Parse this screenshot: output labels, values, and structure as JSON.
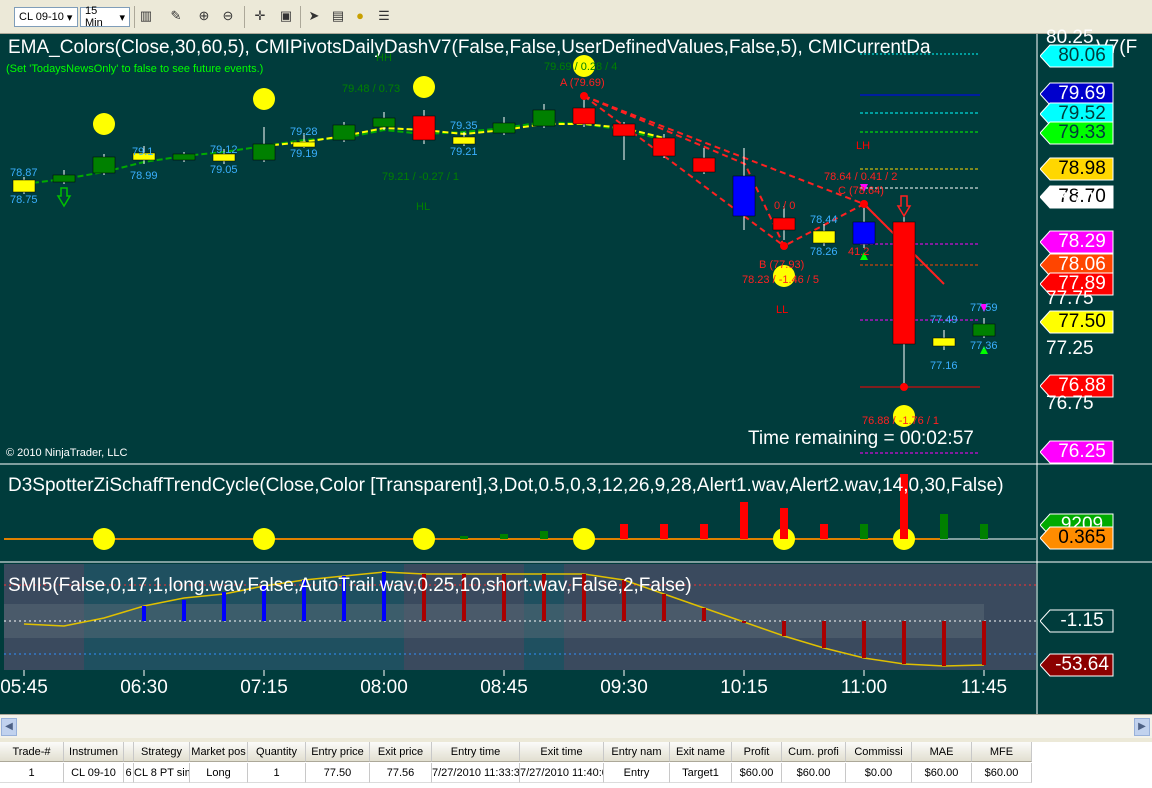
{
  "toolbar": {
    "instrument": "CL 09-10",
    "interval": "15 Min",
    "icons": [
      "bar-style-icon",
      "draw-tool-icon",
      "zoom-in-icon",
      "zoom-out-icon",
      "crosshair-icon",
      "properties-icon",
      "strategy-icon",
      "data-box-icon",
      "money-icon",
      "list-icon"
    ]
  },
  "panels": {
    "price": {
      "indicator_title": "EMA_Colors(Close,30,60,5),  CMIPivotsDailyDashV7(False,False,UserDefinedValues,False,5),  CMICurrentDa",
      "indicator_title_tail": "V7(F",
      "news_note": "(Set 'TodaysNewsOnly' to false to see future events.)",
      "copyright": "© 2010 NinjaTrader, LLC",
      "time_remaining": "Time remaining = 00:02:57"
    },
    "schaff": {
      "indicator_title": "D3SpotterZiSchaffTrendCycle(Close,Color  [Transparent],3,Dot,0.5,0,3,12,26,9,28,Alert1.wav,Alert2.wav,14,0,30,False)"
    },
    "smi": {
      "indicator_title": "SMI5(False,0,17,1,long.wav,False,AutoTrail.wav,0.25,10,short.wav,False,2,False)"
    }
  },
  "price_axis": {
    "ticks": [
      "77.25"
    ],
    "top_partial": "80.25",
    "mid_partial": [
      "76.75",
      "77.75",
      "78.70"
    ]
  },
  "price_tags": [
    {
      "label": "80.06",
      "bg": "#00ffff",
      "fg": "#003c3c"
    },
    {
      "label": "79.69",
      "bg": "#0000cc",
      "fg": "#ffffff"
    },
    {
      "label": "79.52",
      "bg": "#00ffff",
      "fg": "#003c3c"
    },
    {
      "label": "79.33",
      "bg": "#00ff00",
      "fg": "#003c3c"
    },
    {
      "label": "78.98",
      "bg": "#ffd700",
      "fg": "#000000"
    },
    {
      "label": "78.70",
      "bg": "#ffffff",
      "fg": "#000000"
    },
    {
      "label": "78.29",
      "bg": "#ff00ff",
      "fg": "#ffffff"
    },
    {
      "label": "78.06",
      "bg": "#ff4500",
      "fg": "#ffffff"
    },
    {
      "label": "77.89",
      "bg": "#ff0000",
      "fg": "#ffffff"
    },
    {
      "label": "77.50",
      "bg": "#ffff00",
      "fg": "#000000"
    },
    {
      "label": "76.88",
      "bg": "#ff0000",
      "fg": "#ffffff"
    },
    {
      "label": "76.25",
      "bg": "#ff00ff",
      "fg": "#ffffff"
    }
  ],
  "schaff_tags": [
    {
      "label": "9209",
      "bg": "#00aa00",
      "fg": "#ffffff"
    },
    {
      "label": "0.365",
      "bg": "#ff8c00",
      "fg": "#000000"
    }
  ],
  "smi_tags": [
    {
      "label": "-1.15",
      "bg": "#003c3c",
      "fg": "#ffffff"
    },
    {
      "label": "-53.64",
      "bg": "#8b0000",
      "fg": "#ffffff"
    }
  ],
  "time_axis": [
    "05:45",
    "06:30",
    "07:15",
    "08:00",
    "08:45",
    "09:30",
    "10:15",
    "11:00",
    "11:45"
  ],
  "annotations": {
    "hh": "HH",
    "hl": "HL",
    "lh": "LH",
    "ll": "LL",
    "pivot_a": "A (79.69)",
    "pivot_b": "B (77.93)",
    "pivot_c": "C (78.64)",
    "hh_info": "79.48 / 0.73",
    "hl_info": "79.21 / -0.27 / 1",
    "a_info": "79.69 / 0.28 / 4",
    "b_info": "78.23 / -1.46 / 5",
    "c_info": "78.64 / 0.41 / 2",
    "ll_info": "76.88 / -1.76 / 1",
    "zero_info": "0 / 0",
    "bar_labels": [
      "78.87",
      "78.75",
      "79.1",
      "78.99",
      "79.12",
      "79.05",
      "79.28",
      "79.19",
      "79.35",
      "79.21",
      "78.44",
      "78.26",
      "77.49",
      "77.16",
      "77.59",
      "77.36",
      "41.2"
    ]
  },
  "trade_grid": {
    "columns": [
      "Trade-#",
      "Instrumen",
      "",
      "Strategy",
      "Market pos",
      "Quantity",
      "Entry price",
      "Exit price",
      "Entry time",
      "Exit time",
      "Entry nam",
      "Exit name",
      "Profit",
      "Cum. profi",
      "Commissi",
      "MAE",
      "MFE"
    ],
    "rows": [
      [
        "1",
        "CL 09-10",
        "6",
        "CL 8 PT sim",
        "Long",
        "1",
        "77.50",
        "77.56",
        "7/27/2010 11:33:35 A",
        "7/27/2010 11:40:06",
        "Entry",
        "Target1",
        "$60.00",
        "$60.00",
        "$0.00",
        "$60.00",
        "$60.00"
      ]
    ]
  },
  "colors": {
    "background": "#003c3c",
    "up_bar": "#008000",
    "down_bar": "#ff0000",
    "neutral_bar": "#ffff00",
    "dot": "#ffff00"
  }
}
